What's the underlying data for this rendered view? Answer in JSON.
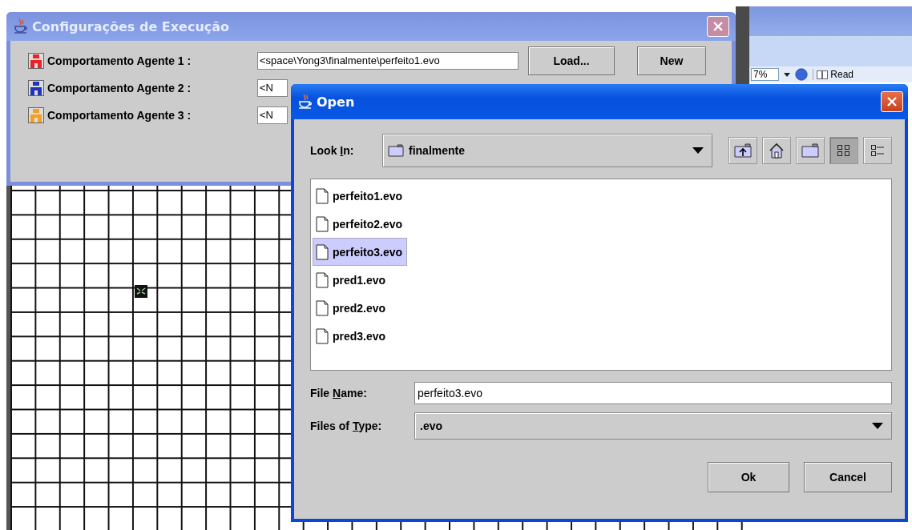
{
  "back_window": {
    "zoom": "7%",
    "read": "Read"
  },
  "config_window": {
    "title": "Configurações de Execução",
    "agents": [
      {
        "label": "Comportamento Agente 1 :",
        "color": "#e8242a",
        "file": "<space\\Yong3\\finalmente\\perfeito1.evo"
      },
      {
        "label": "Comportamento Agente 2 :",
        "color": "#2233bb",
        "file": "<N"
      },
      {
        "label": "Comportamento Agente 3 :",
        "color": "#f5a020",
        "file": "<N"
      }
    ],
    "buttons": [
      "Load...",
      "New"
    ]
  },
  "open_dialog": {
    "title": "Open",
    "look_in": {
      "label_parts": [
        "Look ",
        "I",
        "n:"
      ],
      "value": "finalmente"
    },
    "view_modes": [
      {
        "kind": "list",
        "selected": true
      },
      {
        "kind": "details",
        "selected": false
      }
    ],
    "files": [
      {
        "name": "perfeito1.evo",
        "selected": false
      },
      {
        "name": "perfeito2.evo",
        "selected": false
      },
      {
        "name": "perfeito3.evo",
        "selected": true
      },
      {
        "name": "pred1.evo",
        "selected": false
      },
      {
        "name": "pred2.evo",
        "selected": false
      },
      {
        "name": "pred3.evo",
        "selected": false
      }
    ],
    "file_name": {
      "label_parts": [
        "File ",
        "N",
        "ame:"
      ],
      "value": "perfeito3.evo"
    },
    "files_of_type": {
      "label_parts": [
        "Files of ",
        "T",
        "ype:"
      ],
      "value": ".evo"
    },
    "buttons": [
      "Ok",
      "Cancel"
    ]
  }
}
